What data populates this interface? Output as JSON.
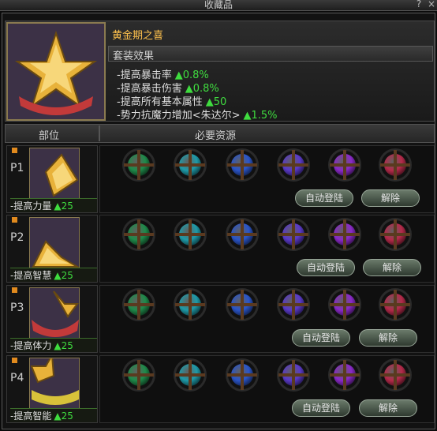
{
  "window": {
    "title": "收藏品",
    "help_label": "?",
    "close_label": "×"
  },
  "set": {
    "name": "黄金期之喜",
    "effect_header": "套装效果",
    "effects": [
      {
        "label": "-提高暴击率",
        "value": "▲0.8%"
      },
      {
        "label": "-提高暴击伤害",
        "value": "▲0.8%"
      },
      {
        "label": "-提高所有基本属性",
        "value": "▲50"
      },
      {
        "label": "-势力抗魔力增加<朱达尔>",
        "value": "▲1.5%"
      }
    ]
  },
  "columns": {
    "part": "部位",
    "required": "必要资源"
  },
  "rows": [
    {
      "pos": "P1",
      "attr": "-提高力量",
      "value": "▲25",
      "auto_label": "自动登陆",
      "remove_label": "解除"
    },
    {
      "pos": "P2",
      "attr": "-提高智慧",
      "value": "▲25",
      "auto_label": "自动登陆",
      "remove_label": "解除"
    },
    {
      "pos": "P3",
      "attr": "-提高体力",
      "value": "▲25",
      "auto_label": "自动登陆",
      "remove_label": "解除"
    },
    {
      "pos": "P4",
      "attr": "-提高智能",
      "value": "▲25",
      "auto_label": "自动登陆",
      "remove_label": "解除"
    }
  ],
  "gem_colors": [
    "#1f8a4a",
    "#1e9aa8",
    "#2a55c8",
    "#5a3ac8",
    "#8a2ac8",
    "#b42a4a"
  ]
}
